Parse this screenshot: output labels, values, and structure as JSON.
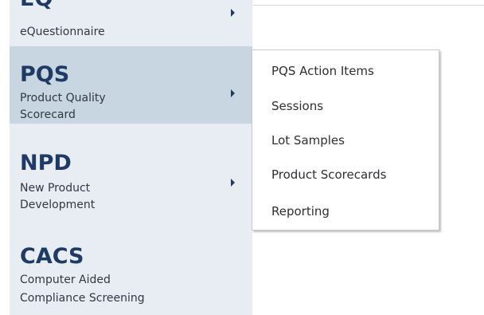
{
  "nav": {
    "items": [
      {
        "code": "EQ",
        "desc_line1": "eQuestionnaire",
        "desc_line2": ""
      },
      {
        "code": "PQS",
        "desc_line1": "Product Quality",
        "desc_line2": "Scorecard"
      },
      {
        "code": "NPD",
        "desc_line1": "New Product",
        "desc_line2": "Development"
      },
      {
        "code": "CACS",
        "desc_line1": "Computer Aided",
        "desc_line2": "Compliance Screening"
      }
    ]
  },
  "submenu": {
    "items": [
      "PQS Action Items",
      "Sessions",
      "Lot Samples",
      "Product Scorecards",
      "Reporting"
    ]
  },
  "icons": {
    "submenu_indicator": "chevron-right-icon"
  },
  "colors": {
    "sidebar_bg": "#e8edf4",
    "active_bg": "#c7d6e1",
    "code_text": "#1f3a64"
  }
}
